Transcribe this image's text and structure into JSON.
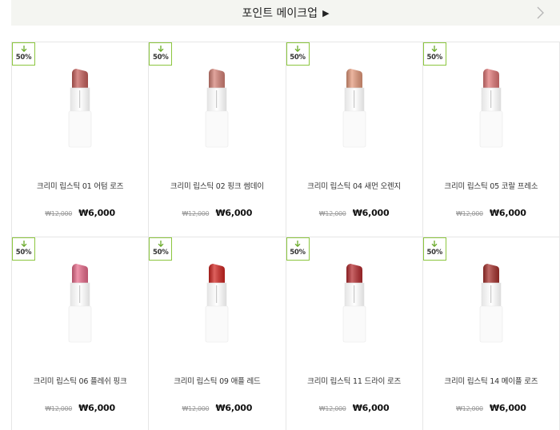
{
  "header": {
    "title": "포인트 메이크업",
    "arrow_icon": "play-triangle-icon",
    "next_icon": "chevron-right-icon"
  },
  "colors": {
    "badge_border": "#8cc63f",
    "badge_arrow": "#6aaa2a",
    "header_bg": "#f4f5f1"
  },
  "products": [
    {
      "name": "크리미 립스틱 01 어텀 로즈",
      "original_price": "₩12,000",
      "sale_price": "₩6,000",
      "discount": "50%",
      "shade": "#c7605c"
    },
    {
      "name": "크리미 립스틱 02 핑크 썸데이",
      "original_price": "₩12,000",
      "sale_price": "₩6,000",
      "discount": "50%",
      "shade": "#d58277"
    },
    {
      "name": "크리미 립스틱 04 새먼 오렌지",
      "original_price": "₩12,000",
      "sale_price": "₩6,000",
      "discount": "50%",
      "shade": "#e59a7c"
    },
    {
      "name": "크리미 립스틱 05 코랄 프레소",
      "original_price": "₩12,000",
      "sale_price": "₩6,000",
      "discount": "50%",
      "shade": "#e07676"
    },
    {
      "name": "크리미 립스틱 06 플레쉬 핑크",
      "original_price": "₩12,000",
      "sale_price": "₩6,000",
      "discount": "50%",
      "shade": "#e96b8b"
    },
    {
      "name": "크리미 립스틱 09 애플 레드",
      "original_price": "₩12,000",
      "sale_price": "₩6,000",
      "discount": "50%",
      "shade": "#d12420"
    },
    {
      "name": "크리미 립스틱 11 드라이 로즈",
      "original_price": "₩12,000",
      "sale_price": "₩6,000",
      "discount": "50%",
      "shade": "#b52a2e"
    },
    {
      "name": "크리미 립스틱 14 메이플 로즈",
      "original_price": "₩12,000",
      "sale_price": "₩6,000",
      "discount": "50%",
      "shade": "#a6302c"
    }
  ]
}
